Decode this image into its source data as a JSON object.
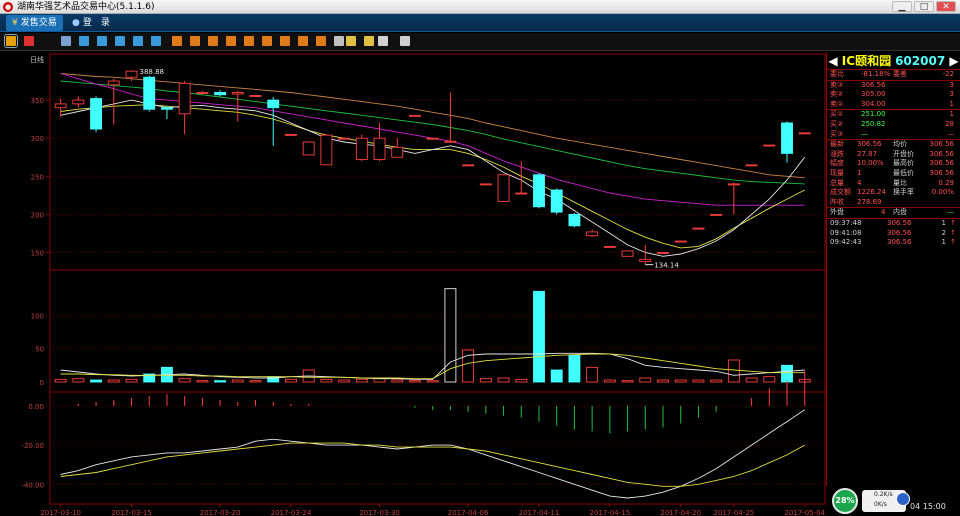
{
  "window": {
    "title": "湖南华强艺术品交易中心(5.1.1.6)",
    "btn_min": "▁",
    "btn_max": "□",
    "btn_close": "✕"
  },
  "menu": {
    "tab1": "发售交易",
    "tab2": "登　录"
  },
  "toolbar": {
    "icons": [
      "kline-icon",
      "trend-icon",
      "list-icon",
      "f1-icon",
      "f2-icon",
      "f3-icon",
      "f4-icon",
      "f5-icon",
      "btn1-icon",
      "btn2-icon",
      "btn3-icon",
      "btn4-icon",
      "btn5-icon",
      "btn6-icon",
      "btn7-icon",
      "btn8-icon",
      "btn9-icon",
      "btn10-icon",
      "zoom-in-icon",
      "zoom-out-icon",
      "draw-icon",
      "settings-icon"
    ]
  },
  "chart_data": {
    "type": "candlestick",
    "period_label": "日线",
    "ylim": [
      127,
      400
    ],
    "yticks": [
      150,
      200,
      250,
      300,
      350
    ],
    "x_labels": [
      "2017-03-10",
      "2017-03-15",
      "2017-03-20",
      "2017-03-24",
      "2017-03-30",
      "2017-04-06",
      "2017-04-11",
      "2017-04-15",
      "2017-04-20",
      "2017-04-25",
      "2017-05-04"
    ],
    "high_marker": "388.88",
    "low_marker": "134.14",
    "candles": [
      {
        "o": 340,
        "c": 345,
        "h": 352,
        "l": 328,
        "v": 4
      },
      {
        "o": 345,
        "c": 350,
        "h": 355,
        "l": 340,
        "v": 5
      },
      {
        "o": 352,
        "c": 312,
        "h": 355,
        "l": 308,
        "v": 3
      },
      {
        "o": 370,
        "c": 375,
        "h": 378,
        "l": 318,
        "v": 3
      },
      {
        "o": 380,
        "c": 388,
        "h": 389,
        "l": 375,
        "v": 4
      },
      {
        "o": 380,
        "c": 338,
        "h": 382,
        "l": 335,
        "v": 12
      },
      {
        "o": 340,
        "c": 338,
        "h": 342,
        "l": 325,
        "v": 22
      },
      {
        "o": 332,
        "c": 372,
        "h": 375,
        "l": 305,
        "v": 5
      },
      {
        "o": 360,
        "c": 360,
        "h": 362,
        "l": 358,
        "v": 2
      },
      {
        "o": 360,
        "c": 357,
        "h": 363,
        "l": 355,
        "v": 2
      },
      {
        "o": 358,
        "c": 360,
        "h": 362,
        "l": 322,
        "v": 3
      },
      {
        "o": 356,
        "c": 356,
        "h": 356,
        "l": 356,
        "v": 2
      },
      {
        "o": 350,
        "c": 340,
        "h": 354,
        "l": 290,
        "v": 8
      },
      {
        "o": 305,
        "c": 305,
        "h": 305,
        "l": 305,
        "v": 4
      },
      {
        "o": 278,
        "c": 295,
        "h": 296,
        "l": 278,
        "v": 18
      },
      {
        "o": 265,
        "c": 304,
        "h": 305,
        "l": 265,
        "v": 4
      },
      {
        "o": 300,
        "c": 300,
        "h": 300,
        "l": 300,
        "v": 3
      },
      {
        "o": 272,
        "c": 300,
        "h": 305,
        "l": 270,
        "v": 4
      },
      {
        "o": 272,
        "c": 300,
        "h": 320,
        "l": 270,
        "v": 5
      },
      {
        "o": 275,
        "c": 288,
        "h": 300,
        "l": 275,
        "v": 3
      },
      {
        "o": 330,
        "c": 330,
        "h": 330,
        "l": 330,
        "v": 2
      },
      {
        "o": 300,
        "c": 300,
        "h": 300,
        "l": 300,
        "v": 2
      },
      {
        "o": 295,
        "c": 296,
        "h": 360,
        "l": 294,
        "v": 140
      },
      {
        "o": 265,
        "c": 265,
        "h": 265,
        "l": 265,
        "v": 48
      },
      {
        "o": 240,
        "c": 240,
        "h": 240,
        "l": 240,
        "v": 5
      },
      {
        "o": 217,
        "c": 252,
        "h": 253,
        "l": 217,
        "v": 6
      },
      {
        "o": 228,
        "c": 228,
        "h": 270,
        "l": 228,
        "v": 4
      },
      {
        "o": 252,
        "c": 210,
        "h": 254,
        "l": 208,
        "v": 136
      },
      {
        "o": 232,
        "c": 203,
        "h": 234,
        "l": 200,
        "v": 18
      },
      {
        "o": 200,
        "c": 185,
        "h": 202,
        "l": 183,
        "v": 40
      },
      {
        "o": 172,
        "c": 177,
        "h": 180,
        "l": 170,
        "v": 22
      },
      {
        "o": 158,
        "c": 158,
        "h": 158,
        "l": 158,
        "v": 3
      },
      {
        "o": 145,
        "c": 152,
        "h": 153,
        "l": 145,
        "v": 2
      },
      {
        "o": 138,
        "c": 141,
        "h": 160,
        "l": 134,
        "v": 6
      },
      {
        "o": 150,
        "c": 150,
        "h": 150,
        "l": 150,
        "v": 3
      },
      {
        "o": 165,
        "c": 165,
        "h": 165,
        "l": 165,
        "v": 3
      },
      {
        "o": 182,
        "c": 182,
        "h": 182,
        "l": 182,
        "v": 3
      },
      {
        "o": 200,
        "c": 200,
        "h": 200,
        "l": 200,
        "v": 3
      },
      {
        "o": 240,
        "c": 240,
        "h": 242,
        "l": 200,
        "v": 33
      },
      {
        "o": 265,
        "c": 265,
        "h": 265,
        "l": 265,
        "v": 6
      },
      {
        "o": 290,
        "c": 291,
        "h": 291,
        "l": 290,
        "v": 8
      },
      {
        "o": 320,
        "c": 280,
        "h": 322,
        "l": 268,
        "v": 25
      },
      {
        "o": 307,
        "c": 307,
        "h": 307,
        "l": 307,
        "v": 4
      }
    ],
    "ma5": [
      330,
      335,
      340,
      345,
      350,
      345,
      340,
      342,
      343,
      340,
      338,
      336,
      330,
      320,
      310,
      300,
      295,
      292,
      290,
      285,
      280,
      285,
      290,
      285,
      270,
      255,
      245,
      230,
      220,
      205,
      190,
      175,
      160,
      150,
      145,
      148,
      155,
      165,
      180,
      200,
      220,
      245,
      275
    ],
    "ma10": [
      335,
      338,
      340,
      342,
      343,
      344,
      342,
      340,
      338,
      336,
      334,
      330,
      325,
      318,
      310,
      304,
      300,
      296,
      292,
      288,
      285,
      285,
      285,
      280,
      272,
      262,
      250,
      240,
      228,
      216,
      204,
      192,
      180,
      170,
      162,
      156,
      158,
      168,
      182,
      195,
      208,
      220,
      232
    ],
    "ma20": [
      385,
      378,
      371,
      365,
      358,
      352,
      350,
      348,
      346,
      344,
      342,
      340,
      336,
      332,
      328,
      324,
      320,
      316,
      312,
      308,
      304,
      300,
      296,
      290,
      280,
      270,
      262,
      254,
      246,
      240,
      234,
      228,
      224,
      220,
      218,
      216,
      214,
      212,
      212,
      212,
      212,
      212,
      212
    ],
    "ma60": [
      375,
      373,
      371,
      369,
      367,
      365,
      362,
      360,
      357,
      354,
      351,
      348,
      345,
      342,
      339,
      336,
      333,
      330,
      327,
      324,
      321,
      318,
      314,
      310,
      305,
      299,
      294,
      289,
      284,
      279,
      274,
      269,
      264,
      260,
      257,
      254,
      251,
      248,
      245,
      243,
      242,
      241,
      240
    ],
    "ma120": [
      385,
      383,
      381,
      380,
      378,
      376,
      374,
      372,
      370,
      368,
      366,
      364,
      362,
      360,
      357,
      354,
      351,
      348,
      345,
      342,
      338,
      334,
      330,
      326,
      320,
      315,
      310,
      305,
      300,
      296,
      292,
      288,
      284,
      280,
      276,
      272,
      268,
      264,
      260,
      256,
      252,
      250,
      248
    ],
    "vol_yticks": [
      0,
      50,
      100
    ],
    "vol_ylim": [
      0,
      150
    ],
    "vol_ma1": [
      18,
      15,
      12,
      10,
      9,
      10,
      11,
      12,
      10,
      8,
      7,
      6,
      6,
      8,
      9,
      8,
      7,
      6,
      5,
      5,
      4,
      4,
      30,
      40,
      42,
      42,
      42,
      42,
      43,
      43,
      43,
      42,
      35,
      25,
      22,
      20,
      18,
      16,
      10,
      12,
      14,
      16,
      18
    ],
    "vol_ma2": [
      12,
      12,
      11,
      11,
      10,
      10,
      10,
      10,
      9,
      9,
      8,
      8,
      8,
      8,
      7,
      7,
      7,
      6,
      6,
      6,
      5,
      5,
      20,
      28,
      32,
      34,
      36,
      38,
      40,
      41,
      42,
      42,
      40,
      36,
      32,
      28,
      24,
      20,
      18,
      16,
      14,
      14,
      14
    ],
    "macd_yticks": [
      "0.00",
      "-20.00",
      "-40.00"
    ],
    "macd_ylim": [
      -48,
      3
    ],
    "macd_bars": [
      0,
      1,
      2,
      3,
      4,
      5,
      6,
      5,
      4,
      3,
      2,
      3,
      2,
      1,
      1,
      0,
      0,
      0,
      0,
      0,
      -1,
      -2,
      -2,
      -3,
      -4,
      -5,
      -6,
      -8,
      -10,
      -12,
      -13,
      -14,
      -13,
      -12,
      -11,
      -9,
      -6,
      -3,
      0,
      4,
      9,
      13,
      18
    ],
    "macd_dif": [
      -35,
      -33,
      -30,
      -28,
      -26,
      -25,
      -24,
      -24,
      -23,
      -22,
      -21,
      -18,
      -17,
      -18,
      -19,
      -20,
      -20,
      -20,
      -21,
      -22,
      -21,
      -20,
      -20,
      -22,
      -25,
      -28,
      -31,
      -34,
      -37,
      -40,
      -43,
      -46,
      -47,
      -46,
      -44,
      -41,
      -37,
      -32,
      -26,
      -20,
      -14,
      -8,
      -2
    ],
    "macd_dea": [
      -36,
      -35,
      -34,
      -32,
      -30,
      -28,
      -26,
      -25,
      -24,
      -23,
      -22,
      -21,
      -20,
      -19,
      -19,
      -19,
      -19,
      -20,
      -20,
      -21,
      -21,
      -21,
      -21,
      -22,
      -23,
      -25,
      -27,
      -29,
      -31,
      -33,
      -35,
      -37,
      -39,
      -40,
      -41,
      -41,
      -40,
      -38,
      -36,
      -33,
      -29,
      -25,
      -20
    ]
  },
  "quote": {
    "name": "IC颐和园",
    "code": "602007",
    "weibi_label": "委比",
    "weibi_val": "-81.18%",
    "weicha_label": "委差",
    "weicha_val": "-22",
    "asks": [
      {
        "label": "卖③",
        "price": "306.56",
        "qty": "3"
      },
      {
        "label": "卖②",
        "price": "305.00",
        "qty": "3"
      },
      {
        "label": "卖①",
        "price": "304.00",
        "qty": "1"
      }
    ],
    "bids": [
      {
        "label": "买①",
        "price": "251.00",
        "qty": "1"
      },
      {
        "label": "买②",
        "price": "250.82",
        "qty": "28"
      },
      {
        "label": "买③",
        "price": "—",
        "qty": "—"
      }
    ],
    "stats": [
      {
        "l1": "最新",
        "v1": "306.56",
        "l2": "均价",
        "v2": "306.56"
      },
      {
        "l1": "涨跌",
        "v1": "27.87",
        "l2": "开盘价",
        "v2": "306.56"
      },
      {
        "l1": "幅度",
        "v1": "10.00%",
        "l2": "最高价",
        "v2": "306.56"
      },
      {
        "l1": "现量",
        "v1": "1",
        "l2": "最低价",
        "v2": "306.56"
      },
      {
        "l1": "总量",
        "v1": "4",
        "l2": "量比",
        "v2": "0.29"
      },
      {
        "l1": "成交额",
        "v1": "1226.24",
        "l2": "换手率",
        "v2": "0.00%"
      },
      {
        "l1": "昨收",
        "v1": "278.69",
        "l2": "",
        "v2": ""
      }
    ],
    "waipan_label": "外盘",
    "waipan_val": "4",
    "neipan_label": "内盘",
    "neipan_val": "—",
    "ticks": [
      {
        "time": "09:37:48",
        "price": "306.56",
        "qty": "1"
      },
      {
        "time": "09:41:08",
        "price": "306.56",
        "qty": "2"
      },
      {
        "time": "09:42:43",
        "price": "306.56",
        "qty": "1"
      }
    ]
  },
  "status": {
    "gauge": "28%",
    "up_speed": "0.2K/s",
    "down_speed": "0K/s",
    "clock": "04 15:00"
  }
}
